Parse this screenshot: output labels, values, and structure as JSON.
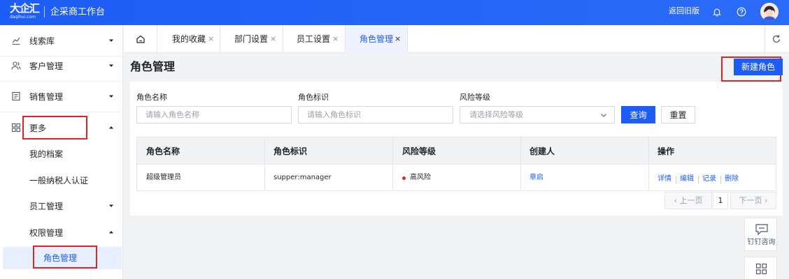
{
  "brand": {
    "logo_text": "大企汇",
    "logo_sub": "daqihui.com",
    "app_title": "企采商工作台",
    "accent_color": "#1e5df5"
  },
  "header": {
    "back_old_label": "返回旧版",
    "icons": [
      "bell-icon",
      "help-icon",
      "avatar"
    ]
  },
  "sidebar": {
    "items": [
      {
        "label": "线索库",
        "icon": "chart-icon",
        "expanded": false
      },
      {
        "label": "客户管理",
        "icon": "users-icon",
        "expanded": false
      },
      {
        "label": "销售管理",
        "icon": "document-icon",
        "expanded": false
      },
      {
        "label": "更多",
        "icon": "grid-icon",
        "expanded": true
      }
    ],
    "sub_items": [
      {
        "label": "我的档案"
      },
      {
        "label": "一般纳税人认证"
      },
      {
        "label": "员工管理",
        "expanded": false
      },
      {
        "label": "权限管理",
        "expanded": true
      }
    ],
    "active_label": "角色管理"
  },
  "tabs": [
    {
      "label": "我的收藏",
      "close": "×"
    },
    {
      "label": "部门设置",
      "close": "×"
    },
    {
      "label": "员工设置",
      "close": "×"
    },
    {
      "label": "角色管理",
      "close": "×",
      "active": true
    }
  ],
  "page": {
    "title": "角色管理",
    "new_button": "新建角色"
  },
  "filters": {
    "role_name": {
      "label": "角色名称",
      "placeholder": "请输入角色名称"
    },
    "role_id": {
      "label": "角色标识",
      "placeholder": "请输入角色标识"
    },
    "risk_level": {
      "label": "风险等级",
      "placeholder": "请选择风险等级"
    },
    "query_button": "查询",
    "reset_button": "重置"
  },
  "table": {
    "headers": [
      "角色名称",
      "角色标识",
      "风险等级",
      "创建人",
      "操作"
    ],
    "rows": [
      {
        "name": "超级管理员",
        "identifier": "supper:manager",
        "risk": "高风险",
        "risk_color": "#e02424",
        "creator": "章启",
        "actions": [
          "详情",
          "编辑",
          "记录",
          "删除"
        ]
      }
    ]
  },
  "pagination": {
    "prev": "上一页",
    "current": "1",
    "next": "下一页"
  },
  "float_widgets": {
    "consult_label": "钉钉咨询"
  }
}
